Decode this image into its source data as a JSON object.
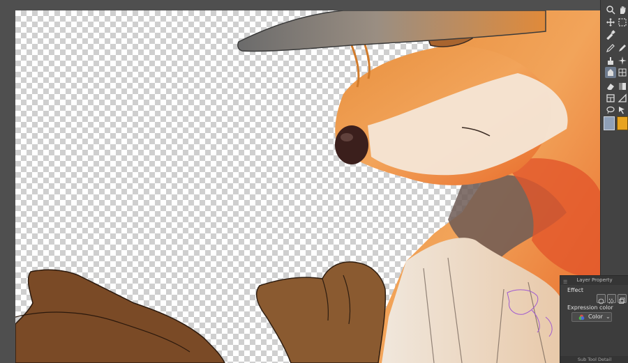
{
  "toolbar": {
    "tools": [
      {
        "name": "zoom-icon",
        "glyph": "🔍"
      },
      {
        "name": "hand-icon",
        "glyph": "✋"
      },
      {
        "name": "move-icon",
        "glyph": "✥"
      },
      {
        "name": "selection-rectangle-icon",
        "glyph": "⬚"
      },
      {
        "name": "eyedropper-icon",
        "glyph": "⤡"
      },
      {
        "name": "pen-icon",
        "glyph": "✒"
      },
      {
        "name": "pencil-icon",
        "glyph": "✎"
      },
      {
        "name": "brush-icon",
        "glyph": "⚱"
      },
      {
        "name": "decoration-icon",
        "glyph": "✦"
      },
      {
        "name": "fill-icon",
        "glyph": "▧"
      },
      {
        "name": "grid-icon",
        "glyph": "▦"
      },
      {
        "name": "eraser-icon",
        "glyph": "⌫"
      },
      {
        "name": "gradient-icon",
        "glyph": "◧"
      },
      {
        "name": "frame-icon",
        "glyph": "▣"
      },
      {
        "name": "ruler-icon",
        "glyph": "◤"
      },
      {
        "name": "lasso-icon",
        "glyph": "◯"
      },
      {
        "name": "object-icon",
        "glyph": "↖"
      }
    ],
    "main_color": "#8fa0b8",
    "sub_color": "#e8a31f"
  },
  "layer_property": {
    "title": "Layer Property",
    "effect_label": "Effect",
    "expression_color_label": "Expression color",
    "expression_color_value": "Color",
    "footer": "Sub Tool Detail"
  }
}
